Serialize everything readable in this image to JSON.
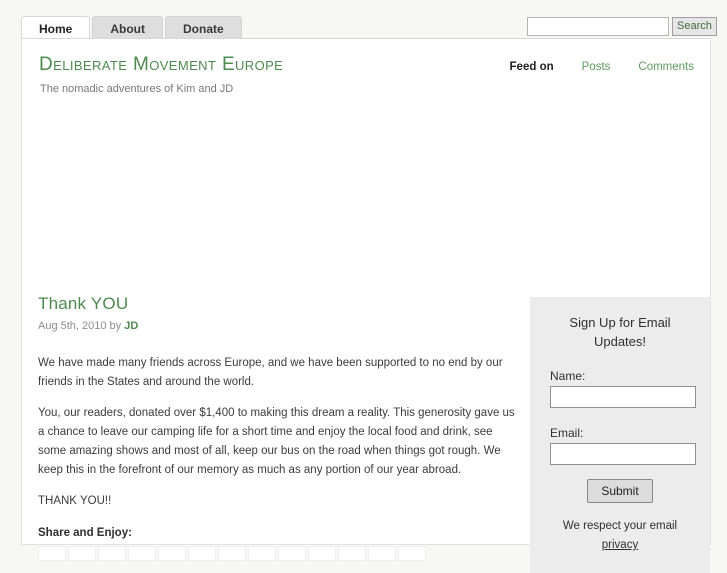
{
  "nav": {
    "tabs": [
      {
        "label": "Home",
        "active": true
      },
      {
        "label": "About",
        "active": false
      },
      {
        "label": "Donate",
        "active": false
      }
    ]
  },
  "search": {
    "value": "",
    "placeholder": "",
    "button_label": "Search"
  },
  "site": {
    "title": "Deliberate Movement Europe",
    "tagline": "The nomadic adventures of Kim and JD"
  },
  "feed": {
    "label": "Feed on",
    "links": [
      {
        "label": "Posts"
      },
      {
        "label": "Comments"
      }
    ]
  },
  "post": {
    "title": "Thank YOU",
    "date": "Aug 5th, 2010 by",
    "author": "JD",
    "paragraphs": [
      "We have made many friends across Europe, and we have been supported to no end by our friends in the States and around the world.",
      "You, our readers, donated over $1,400 to making this dream a reality. This generosity gave us a chance to leave our camping life for a short time and enjoy the local food and drink, see some amazing shows and most of all, keep our bus on the road when things got rough. We keep this in the forefront of our memory as much as any portion of our year abroad.",
      "THANK YOU!!"
    ],
    "share_title": "Share and Enjoy:",
    "share_count": 13
  },
  "sidebar": {
    "widget_title": "Sign Up for Email Updates!",
    "name_label": "Name:",
    "name_value": "",
    "email_label": "Email:",
    "email_value": "",
    "submit_label": "Submit",
    "privacy_text": "We respect your email",
    "privacy_link": "privacy"
  },
  "colors": {
    "accent_green": "#4e8a4e",
    "link_green": "#5f9a5f",
    "page_bg": "#f7f7f5",
    "sidebar_bg": "#ececec"
  }
}
